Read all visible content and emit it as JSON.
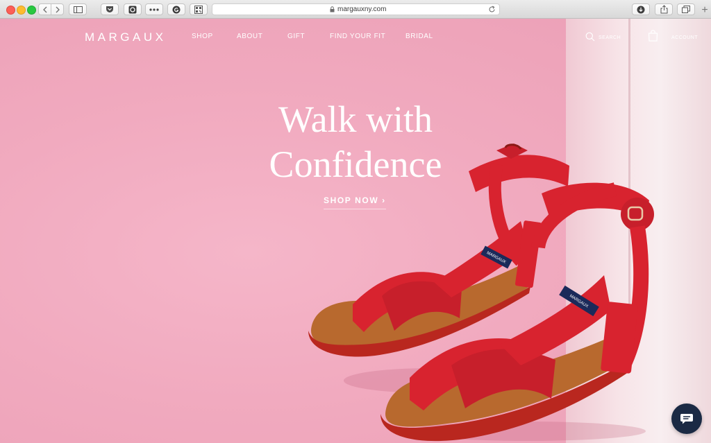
{
  "browser": {
    "url": "margauxny.com",
    "new_tab_glyph": "+",
    "toolbar_icons": [
      "back-icon",
      "forward-icon",
      "sidebar-icon",
      "pocket-icon",
      "extension-icon",
      "more-icon",
      "grammarly-icon",
      "qr-icon",
      "lock-icon",
      "reload-icon",
      "download-icon",
      "share-icon",
      "tabs-icon"
    ]
  },
  "nav": {
    "logo": "MARGAUX",
    "links": [
      "SHOP",
      "ABOUT",
      "GIFT",
      "FIND YOUR FIT",
      "BRIDAL"
    ],
    "search_label": "SEARCH",
    "account_label": "ACCOUNT"
  },
  "hero": {
    "title_line1": "Walk with",
    "title_line2": "Confidence",
    "cta": "SHOP NOW ›",
    "product_brand_label": "MARGAUX"
  },
  "chat": {
    "icon": "chat-icon"
  },
  "colors": {
    "background_pink": "#f1aabf",
    "sandal_red": "#d8232f",
    "insole_tan": "#b8692e",
    "chat_navy": "#1b2a44",
    "text_white": "#ffffff"
  }
}
